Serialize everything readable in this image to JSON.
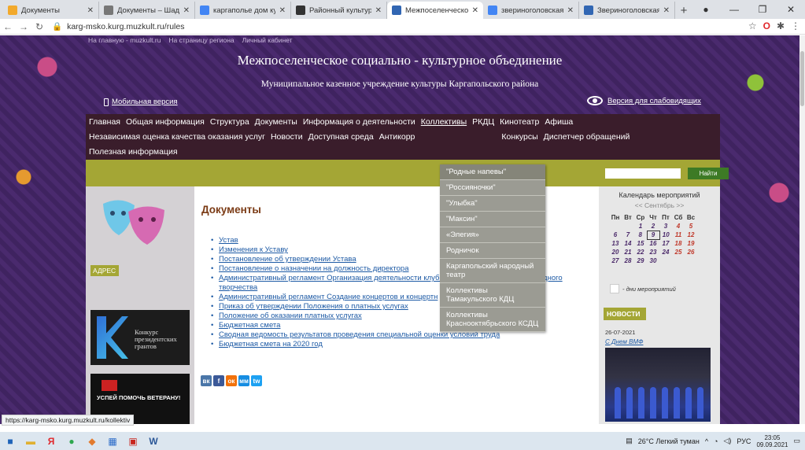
{
  "browser": {
    "tabs": [
      {
        "title": "Документы",
        "color": "#f2a92c",
        "active": false
      },
      {
        "title": "Документы – Шадри",
        "color": "#777777",
        "active": false
      },
      {
        "title": "каргаполье дом куль",
        "color": "#4285f4",
        "active": false
      },
      {
        "title": "Районный культурны",
        "color": "#333333",
        "active": false
      },
      {
        "title": "Межпоселенческое",
        "color": "#3166b3",
        "active": true
      },
      {
        "title": "звериноголовская б",
        "color": "#4285f4",
        "active": false
      },
      {
        "title": "Звериноголовская ц",
        "color": "#3166b3",
        "active": false
      }
    ],
    "url": "karg-msko.kurg.muzkult.ru/rules",
    "status_url": "https://karg-msko.kurg.muzkult.ru/kollektiv"
  },
  "site": {
    "top_links": [
      "На главную - muzkult.ru",
      "На страницу региона",
      "Личный кабинет"
    ],
    "title": "Межпоселенческое социально - культурное объединение",
    "subtitle": "Муниципальное казенное учреждение культуры Каргапольского района",
    "mobile_label": "Мобильная версия",
    "low_vision_label": "Версия для слабовидящих",
    "search_button": "Найти"
  },
  "nav": {
    "row1": [
      "Главная",
      "Общая информация",
      "Структура",
      "Документы",
      "Информация о деятельности",
      "Коллективы",
      "РКДЦ",
      "Кинотеатр",
      "Афиша"
    ],
    "row2": [
      "Независимая оценка качества оказания услуг",
      "Новости",
      "Доступная среда",
      "Антикорр",
      "Конкурсы",
      "Диспетчер обращений"
    ],
    "row3": [
      "Полезная информация"
    ]
  },
  "dropdown": {
    "items": [
      "\"Родные напевы\"",
      "\"Россияночки\"",
      "\"Улыбка\"",
      "\"Максин\"",
      "«Элегия»",
      "Родничок",
      "Каргапольский народный театр",
      "Коллективы Тамакульского КДЦ",
      "Коллективы Красноoктябрьского КСДЦ"
    ]
  },
  "left": {
    "address_label": "АДРЕС",
    "banner1_text": "Конкурс президентских грантов",
    "banner2_text": "УСПЕЙ ПОМОЧЬ ВЕТЕРАНУ!"
  },
  "main": {
    "heading": "Документы",
    "docs": [
      "Устав",
      "Изменения к Уставу",
      "Постановление об утверждении Устава",
      "Постановление о назначении на должность директора",
      "Административный регламент Организация деятельности клубн                                   аний самодеятельного народного творчества",
      "Административный регламент Создание концертов и концертн",
      "Приказ об утверждении Положения о платных услугах",
      "Положение об оказании платных услугах",
      "Бюджетная смета",
      "Сводная ведомость результатов проведения специальной оценки условий труда",
      "Бюджетная смета на 2020 год"
    ],
    "social": [
      "вк",
      "f",
      "ок",
      "мм",
      "tw"
    ]
  },
  "right": {
    "calendar_title": "Календарь мероприятий",
    "calendar_month": "<< Сентябрь >>",
    "weekdays": [
      "Пн",
      "Вт",
      "Ср",
      "Чт",
      "Пт",
      "Сб",
      "Вс"
    ],
    "weeks": [
      [
        "",
        "",
        "1",
        "2",
        "3",
        "4",
        "5"
      ],
      [
        "6",
        "7",
        "8",
        "9",
        "10",
        "11",
        "12"
      ],
      [
        "13",
        "14",
        "15",
        "16",
        "17",
        "18",
        "19"
      ],
      [
        "20",
        "21",
        "22",
        "23",
        "24",
        "25",
        "26"
      ],
      [
        "27",
        "28",
        "29",
        "30",
        "",
        "",
        ""
      ]
    ],
    "today": "9",
    "legend": "- дни мероприятий",
    "news_label": "НОВОСТИ",
    "news_date": "26-07-2021",
    "news_link": "С Днем ВМФ"
  },
  "taskbar": {
    "weather": "26°C Легкий туман",
    "lang": "РУС",
    "time": "23:05",
    "date": "09.09.2021"
  }
}
